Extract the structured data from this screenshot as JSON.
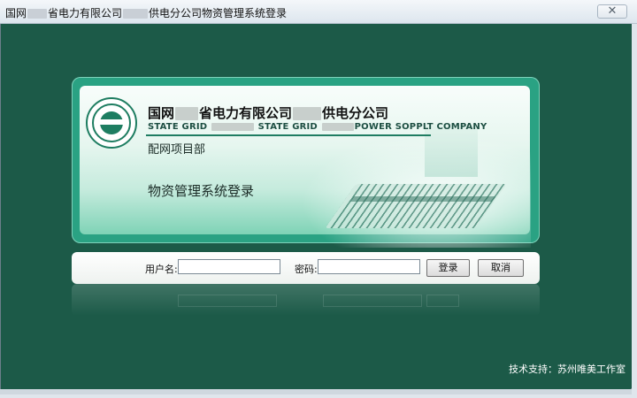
{
  "window": {
    "title_prefix": "国网",
    "title_mid": "省电力有限公司",
    "title_suffix": "供电分公司物资管理系统登录",
    "close_label": "✕"
  },
  "banner": {
    "cn_prefix": "国网",
    "cn_mid": "省电力有限公司",
    "cn_suffix": "供电分公司",
    "en_part1": "STATE GRID",
    "en_part2": "STATE GRID",
    "en_part3": "POWER SOPPLT COMPANY",
    "department": "配网项目部",
    "system_title": "物资管理系统登录"
  },
  "login": {
    "username_label": "用户名:",
    "username_value": "",
    "password_label": "密码:",
    "password_value": "",
    "login_button": "登录",
    "cancel_button": "取消"
  },
  "footer": {
    "support_text": "技术支持：苏州唯美工作室"
  },
  "colors": {
    "background": "#1c5a48",
    "banner_frame": "#2aa283",
    "accent": "#1e7d61"
  }
}
